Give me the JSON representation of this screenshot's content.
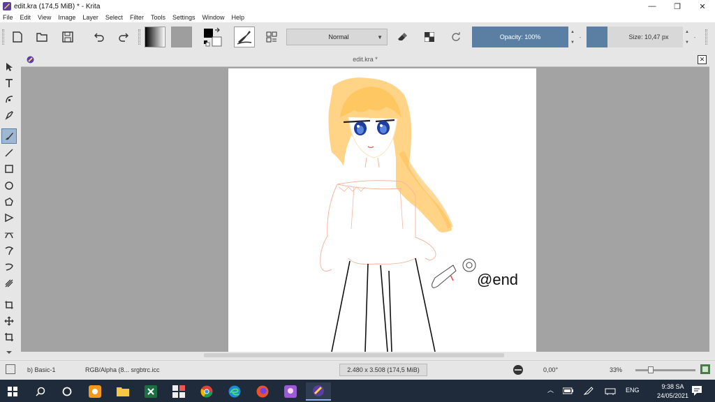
{
  "window": {
    "title": "edit.kra (174,5 MiB)  * - Krita",
    "minimize": "—",
    "restore": "❐",
    "close": "✕"
  },
  "menu": [
    "File",
    "Edit",
    "View",
    "Image",
    "Layer",
    "Select",
    "Filter",
    "Tools",
    "Settings",
    "Window",
    "Help"
  ],
  "toolbar": {
    "blend_mode": "Normal",
    "opacity_label": "Opacity: 100%",
    "opacity_value": 100,
    "size_label": "Size: 10,47 px",
    "accent_color": "#5b7fa3"
  },
  "document": {
    "tab_title": "edit.kra *",
    "canvas_text": "@end"
  },
  "status": {
    "brush": "b) Basic-1",
    "colorspace": "RGB/Alpha (8... srgbtrc.icc",
    "image_size": "2.480 x 3.508 (174,5 MiB)",
    "rotation": "0,00°",
    "zoom": "33%"
  },
  "taskbar": {
    "language": "ENG",
    "time": "9:38 SA",
    "date": "24/05/2021"
  },
  "icons": {
    "toolbar": [
      "new-document-icon",
      "open-folder-icon",
      "save-icon",
      "undo-icon",
      "redo-icon",
      "eraser-icon",
      "alpha-lock-icon",
      "reload-preset-icon"
    ],
    "toolbox": [
      "select-shapes-icon",
      "text-icon",
      "edit-shapes-icon",
      "calligraphy-icon",
      "freehand-brush-icon",
      "line-icon",
      "rectangle-icon",
      "ellipse-icon",
      "polygon-icon",
      "polyline-icon",
      "bezier-icon",
      "freehand-path-icon",
      "dynamic-brush-icon",
      "multibrush-icon",
      "crop-icon",
      "move-icon",
      "transform-icon"
    ]
  }
}
